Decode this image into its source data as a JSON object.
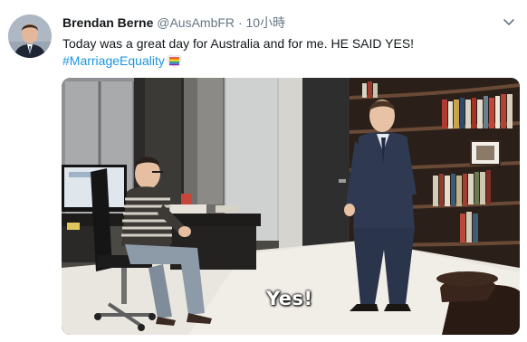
{
  "tweet": {
    "display_name": "Brendan Berne",
    "handle": "@AusAmbFR",
    "separator": "·",
    "timestamp": "10小時",
    "text": "Today was a great day for Australia and for me. HE SAID YES!",
    "hashtag": "#MarriageEquality",
    "hashtag_emoji": "rainbow-heart-icon"
  },
  "media": {
    "caption": "Yes!"
  },
  "colors": {
    "name": "#14171a",
    "meta": "#657786",
    "link": "#1b95e0"
  }
}
